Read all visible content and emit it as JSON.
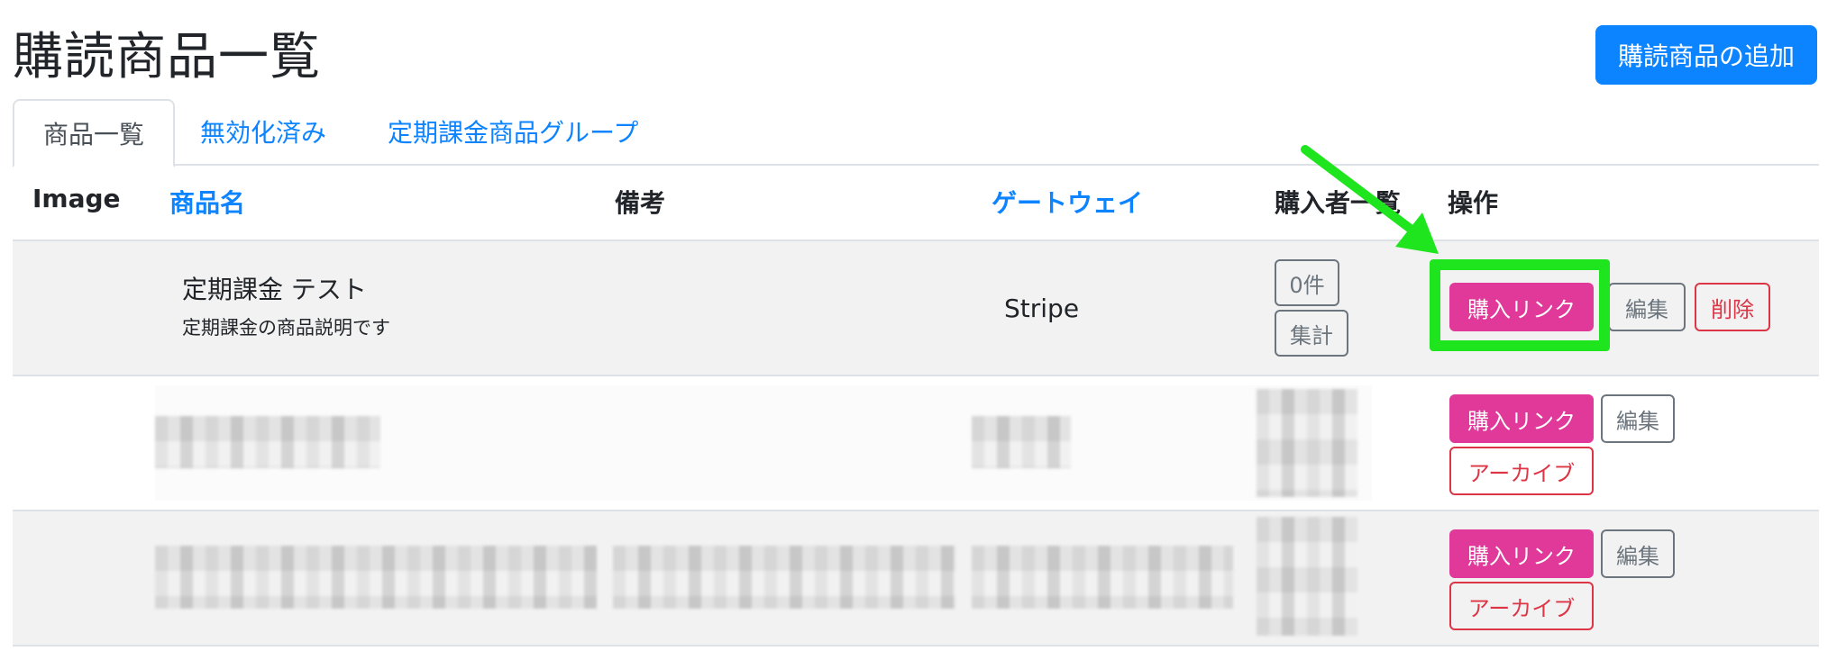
{
  "page": {
    "title": "購読商品一覧",
    "add_button": "購読商品の追加"
  },
  "tabs": [
    {
      "label": "商品一覧",
      "active": true
    },
    {
      "label": "無効化済み",
      "active": false
    },
    {
      "label": "定期課金商品グループ",
      "active": false
    }
  ],
  "table": {
    "headers": {
      "image": "Image",
      "name": "商品名",
      "note": "備考",
      "gateway": "ゲートウェイ",
      "buyers": "購入者一覧",
      "actions": "操作"
    },
    "rows": [
      {
        "name": "定期課金 テスト",
        "description": "定期課金の商品説明です",
        "gateway": "Stripe",
        "buyer_count": "0件",
        "buyer_summary": "集計",
        "buy_link": "購入リンク",
        "edit": "編集",
        "delete": "削除"
      },
      {
        "buy_link": "購入リンク",
        "edit": "編集",
        "archive": "アーカイブ"
      },
      {
        "buy_link": "購入リンク",
        "edit": "編集",
        "archive": "アーカイブ"
      }
    ]
  },
  "colors": {
    "primary": "#0d84ff",
    "pink": "#e0399a",
    "danger": "#dc3545",
    "secondary": "#6c757d",
    "annotation": "#1fe51f"
  },
  "annotation": {
    "type": "green arrow and box highlighting purchase link button"
  }
}
